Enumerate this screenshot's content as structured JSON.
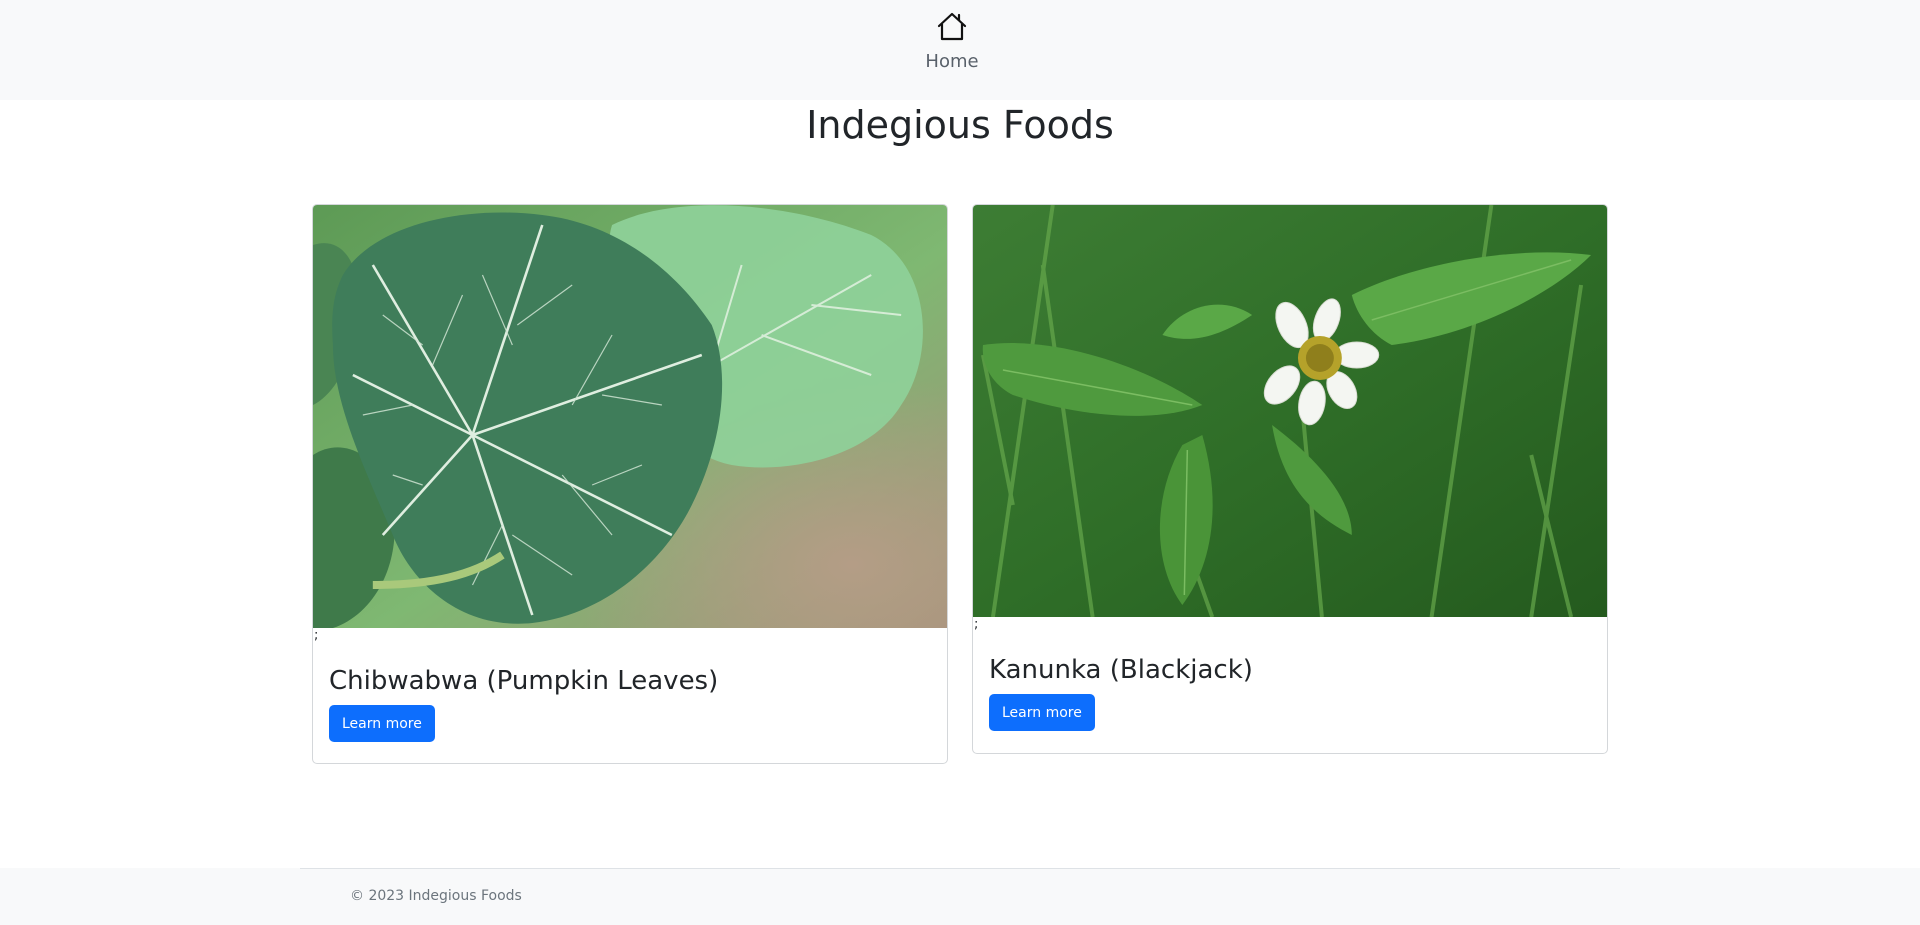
{
  "nav": {
    "home_label": "Home",
    "home_icon": "house-icon"
  },
  "page": {
    "title": "Indegious Foods"
  },
  "cards": [
    {
      "image_icon": "pumpkin-leaves-photo",
      "stray_text": ";",
      "title": "Chibwabwa (Pumpkin Leaves)",
      "button_label": "Learn more"
    },
    {
      "image_icon": "blackjack-flower-photo",
      "stray_text": ";",
      "title": "Kanunka (Blackjack)",
      "button_label": "Learn more"
    }
  ],
  "footer": {
    "copyright": "© 2023 Indegious Foods"
  },
  "colors": {
    "primary": "#0d6efd",
    "nav_bg": "#f8f9fa",
    "text": "#212529",
    "muted": "#6c757d"
  }
}
